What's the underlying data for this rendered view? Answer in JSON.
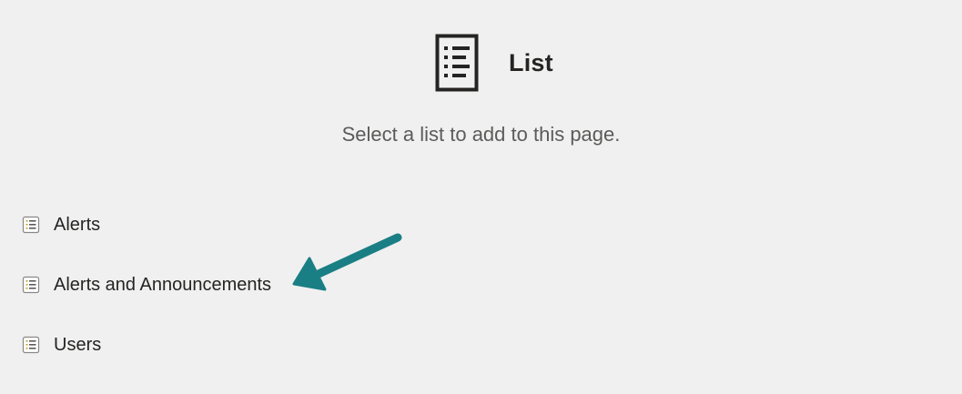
{
  "header": {
    "icon": "list-document-icon",
    "title": "List"
  },
  "subtitle": "Select a list to add to this page.",
  "lists": {
    "icon": "list-icon",
    "items": [
      {
        "label": "Alerts"
      },
      {
        "label": "Alerts and Announcements"
      },
      {
        "label": "Users"
      }
    ]
  },
  "annotation": {
    "icon": "arrow-pointer",
    "color": "#1a7f84"
  }
}
